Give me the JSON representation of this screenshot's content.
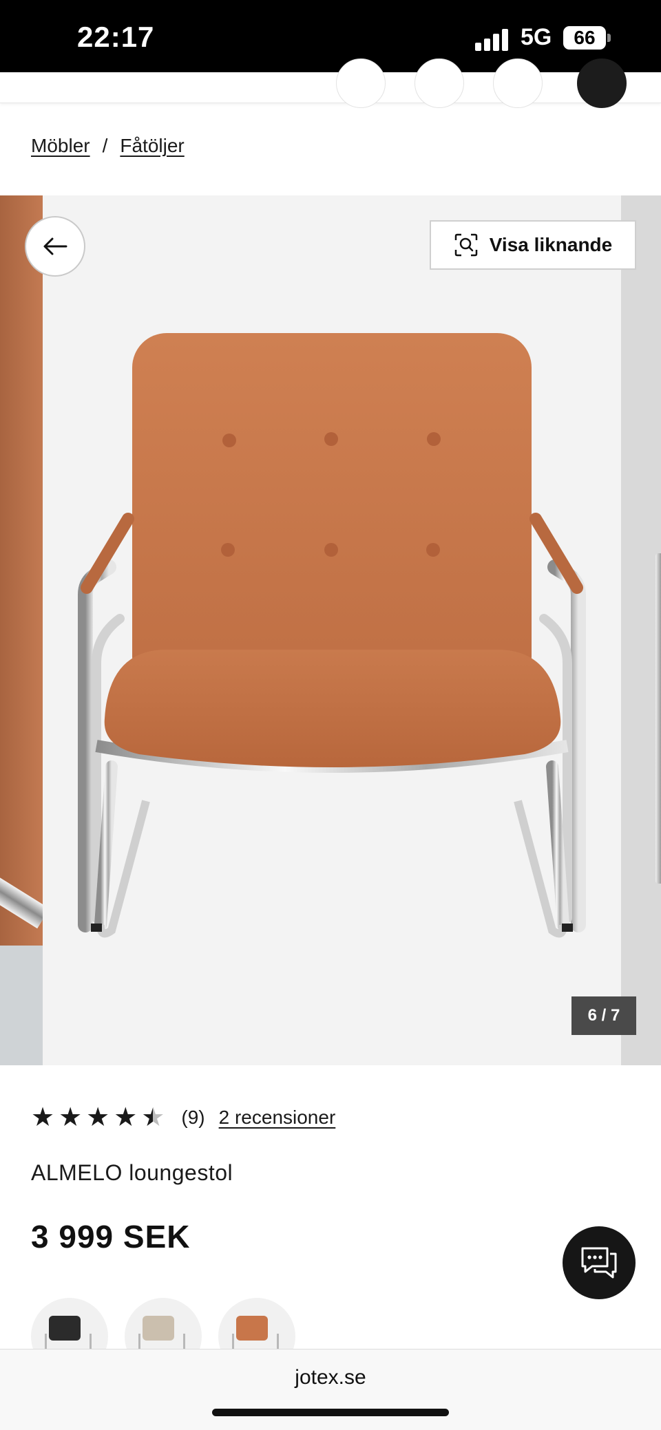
{
  "status_bar": {
    "time": "22:17",
    "network": "5G",
    "battery": "66"
  },
  "breadcrumb": {
    "items": [
      "Möbler",
      "Fåtöljer"
    ],
    "separator": "/"
  },
  "gallery": {
    "similar_button_label": "Visa liknande",
    "counter": "6 / 7",
    "colors": {
      "upholstery": "#c8764a",
      "background": "#f3f3f3"
    }
  },
  "product": {
    "rating_value": 4.5,
    "rating_max": 5,
    "rating_count": "(9)",
    "reviews_link": "2 recensioner",
    "name": "ALMELO loungestol",
    "price": "3 999 SEK",
    "variants": [
      {
        "color": "#2b2b2b"
      },
      {
        "color": "#cbbfae"
      },
      {
        "color": "#c8764a"
      }
    ]
  },
  "browser": {
    "url": "jotex.se"
  },
  "icons": {
    "back": "arrow-left-icon",
    "similar": "visual-search-icon",
    "chat": "chat-icon"
  }
}
